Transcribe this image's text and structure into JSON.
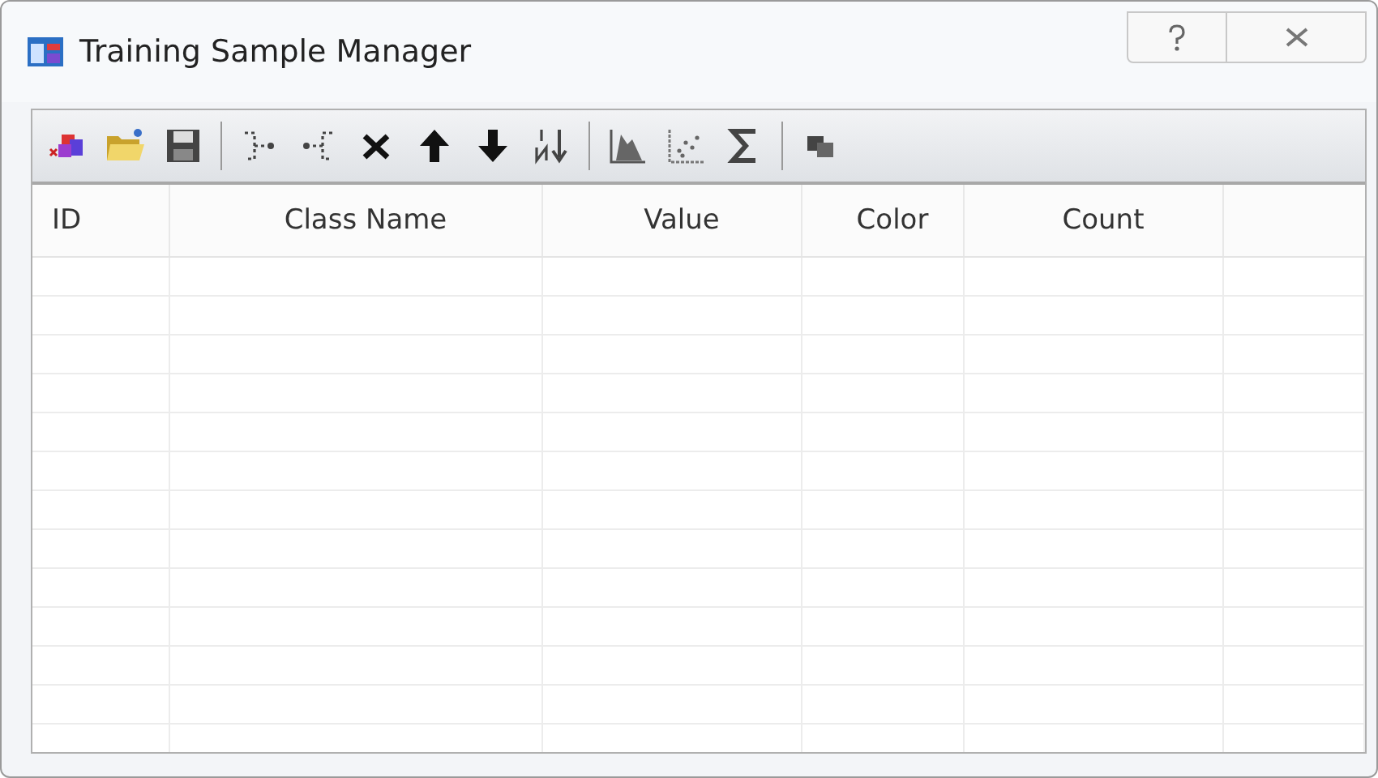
{
  "window": {
    "title": "Training Sample Manager"
  },
  "table": {
    "columns": [
      "ID",
      "Class Name",
      "Value",
      "Color",
      "Count"
    ]
  }
}
